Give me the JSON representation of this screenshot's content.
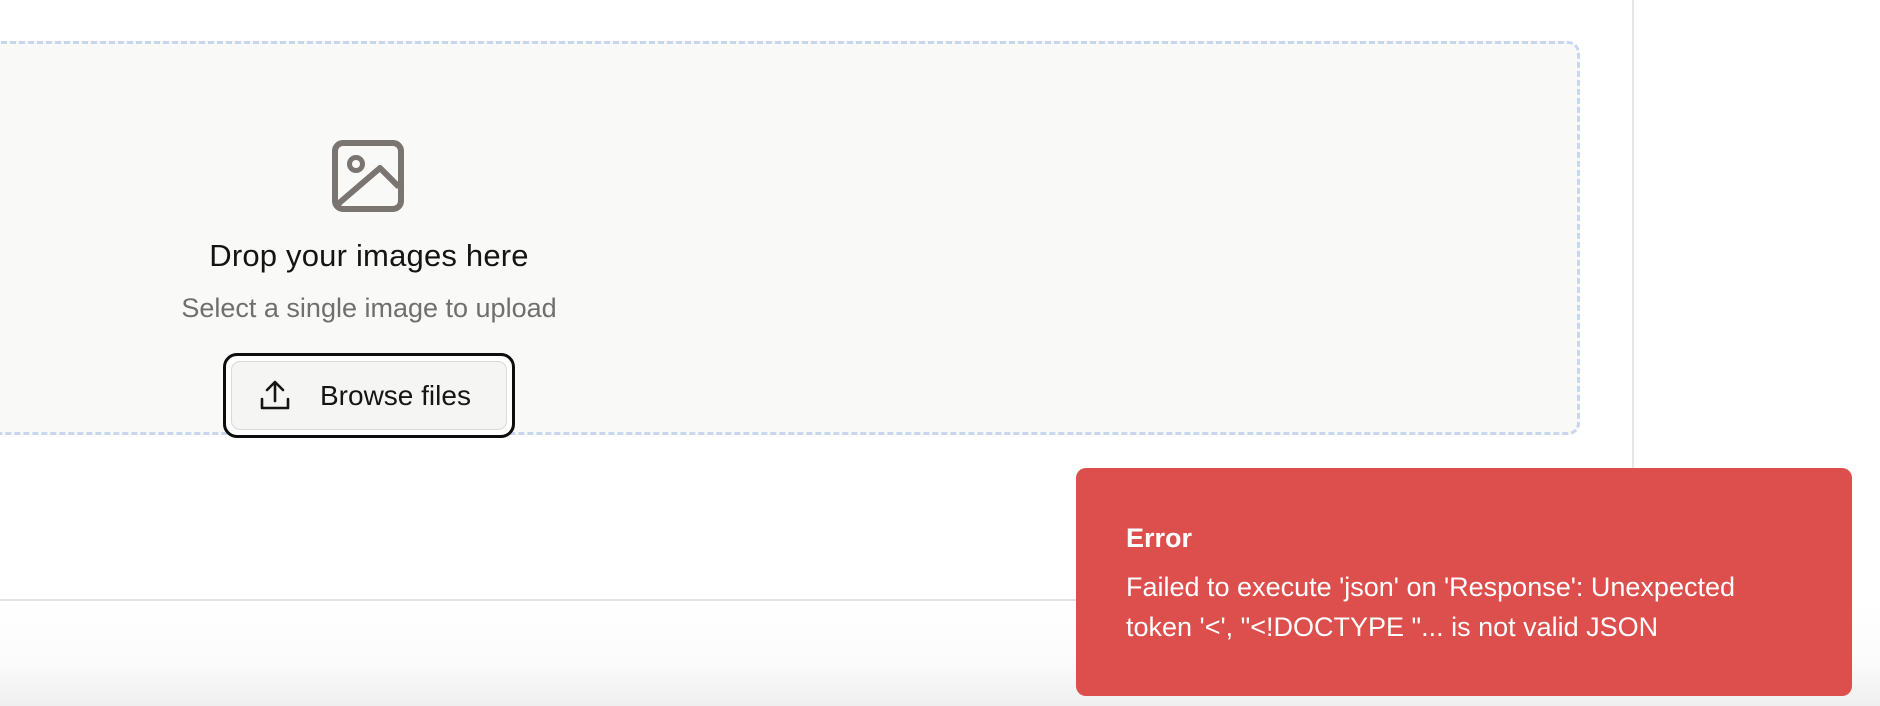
{
  "dropzone": {
    "icon": "image-icon",
    "title": "Drop your images here",
    "subtitle": "Select a single image to upload",
    "button": {
      "icon": "upload-icon",
      "label": "Browse files"
    }
  },
  "toast": {
    "title": "Error",
    "message": "Failed to execute 'json' on 'Response': Unexpected token '<', \"<!DOCTYPE \"... is not valid JSON",
    "color": "#dc4f4c"
  },
  "colors": {
    "dropzone_border": "#c8d6ee",
    "dropzone_background": "#f9f9f7",
    "icon": "#7a7571"
  }
}
